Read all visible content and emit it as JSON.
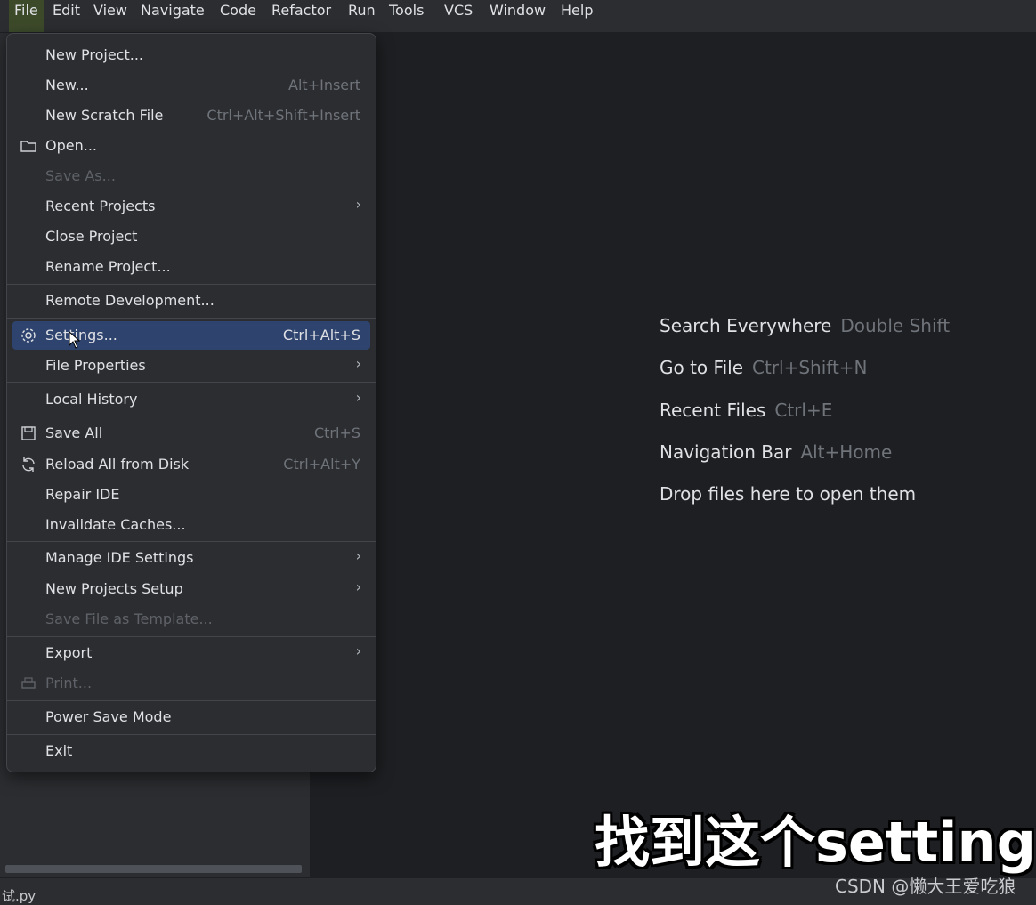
{
  "menubar": {
    "items": [
      "File",
      "Edit",
      "View",
      "Navigate",
      "Code",
      "Refactor",
      "Run",
      "Tools",
      "VCS",
      "Window",
      "Help"
    ]
  },
  "file_menu": {
    "items": [
      {
        "label": "New Project...",
        "shortcut": "",
        "submenu": false,
        "disabled": false,
        "icon": ""
      },
      {
        "label": "New...",
        "shortcut": "Alt+Insert",
        "submenu": false,
        "disabled": false,
        "icon": ""
      },
      {
        "label": "New Scratch File",
        "shortcut": "Ctrl+Alt+Shift+Insert",
        "submenu": false,
        "disabled": false,
        "icon": ""
      },
      {
        "label": "Open...",
        "shortcut": "",
        "submenu": false,
        "disabled": false,
        "icon": "folder-icon"
      },
      {
        "label": "Save As...",
        "shortcut": "",
        "submenu": false,
        "disabled": true,
        "icon": ""
      },
      {
        "label": "Recent Projects",
        "shortcut": "",
        "submenu": true,
        "disabled": false,
        "icon": ""
      },
      {
        "label": "Close Project",
        "shortcut": "",
        "submenu": false,
        "disabled": false,
        "icon": ""
      },
      {
        "label": "Rename Project...",
        "shortcut": "",
        "submenu": false,
        "disabled": false,
        "icon": ""
      },
      {
        "label": "Remote Development...",
        "shortcut": "",
        "submenu": false,
        "disabled": false,
        "icon": ""
      },
      {
        "label": "Settings...",
        "shortcut": "Ctrl+Alt+S",
        "submenu": false,
        "disabled": false,
        "icon": "gear-icon",
        "highlighted": true
      },
      {
        "label": "File Properties",
        "shortcut": "",
        "submenu": true,
        "disabled": false,
        "icon": ""
      },
      {
        "label": "Local History",
        "shortcut": "",
        "submenu": true,
        "disabled": false,
        "icon": ""
      },
      {
        "label": "Save All",
        "shortcut": "Ctrl+S",
        "submenu": false,
        "disabled": false,
        "icon": "save-icon"
      },
      {
        "label": "Reload All from Disk",
        "shortcut": "Ctrl+Alt+Y",
        "submenu": false,
        "disabled": false,
        "icon": "reload-icon"
      },
      {
        "label": "Repair IDE",
        "shortcut": "",
        "submenu": false,
        "disabled": false,
        "icon": ""
      },
      {
        "label": "Invalidate Caches...",
        "shortcut": "",
        "submenu": false,
        "disabled": false,
        "icon": ""
      },
      {
        "label": "Manage IDE Settings",
        "shortcut": "",
        "submenu": true,
        "disabled": false,
        "icon": ""
      },
      {
        "label": "New Projects Setup",
        "shortcut": "",
        "submenu": true,
        "disabled": false,
        "icon": ""
      },
      {
        "label": "Save File as Template...",
        "shortcut": "",
        "submenu": false,
        "disabled": true,
        "icon": ""
      },
      {
        "label": "Export",
        "shortcut": "",
        "submenu": true,
        "disabled": false,
        "icon": ""
      },
      {
        "label": "Print...",
        "shortcut": "",
        "submenu": false,
        "disabled": true,
        "icon": "print-icon"
      },
      {
        "label": "Power Save Mode",
        "shortcut": "",
        "submenu": false,
        "disabled": false,
        "icon": ""
      },
      {
        "label": "Exit",
        "shortcut": "",
        "submenu": false,
        "disabled": false,
        "icon": ""
      }
    ]
  },
  "editor_hints": [
    {
      "label": "Search Everywhere",
      "key": "Double Shift"
    },
    {
      "label": "Go to File",
      "key": "Ctrl+Shift+N"
    },
    {
      "label": "Recent Files",
      "key": "Ctrl+E"
    },
    {
      "label": "Navigation Bar",
      "key": "Alt+Home"
    },
    {
      "label": "Drop files here to open them",
      "key": ""
    }
  ],
  "statusbar": {
    "file": "试.py"
  },
  "overlay_caption": "找到这个settings",
  "watermark": "CSDN @懒大王爱吃狼"
}
